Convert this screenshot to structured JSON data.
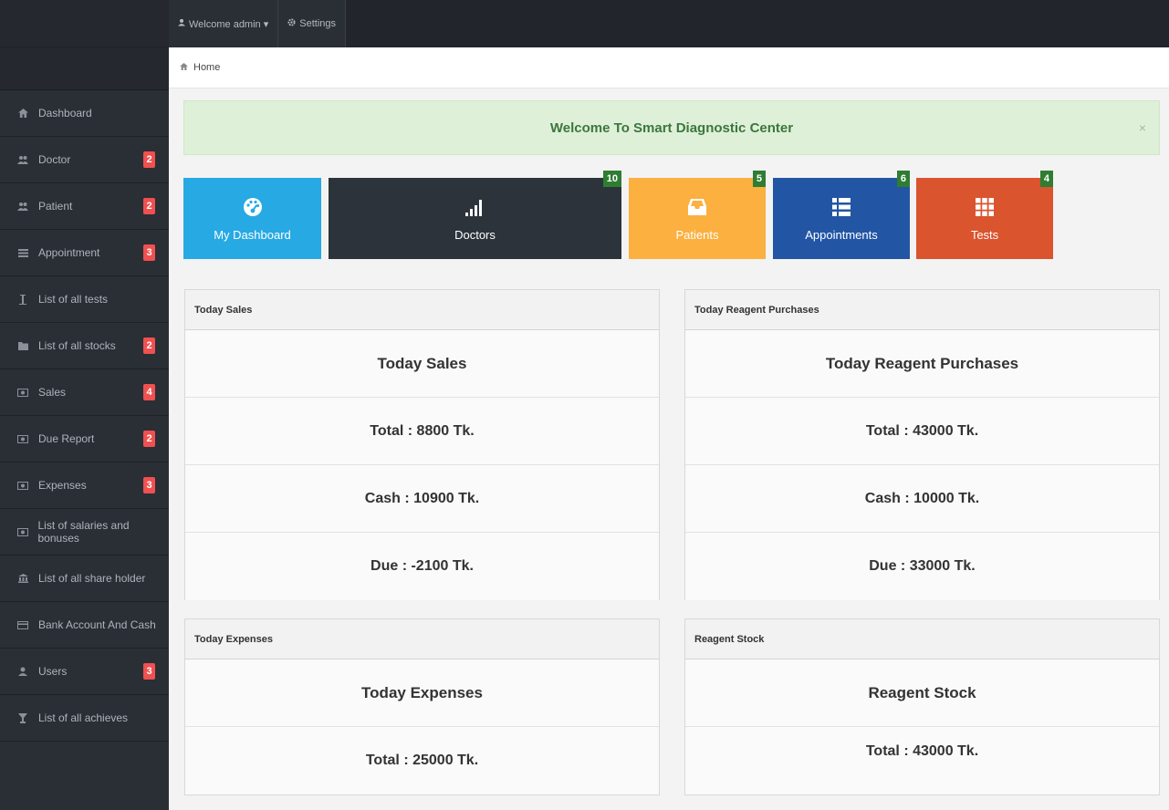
{
  "topbar": {
    "welcome": "Welcome admin ▾",
    "settings": "Settings"
  },
  "breadcrumb": {
    "home": "Home"
  },
  "sidebar": {
    "items": [
      {
        "label": "Dashboard",
        "icon": "home-icon",
        "badge": ""
      },
      {
        "label": "Doctor",
        "icon": "users-icon",
        "badge": "2"
      },
      {
        "label": "Patient",
        "icon": "users-icon",
        "badge": "2"
      },
      {
        "label": "Appointment",
        "icon": "list-icon",
        "badge": "3"
      },
      {
        "label": "List of all tests",
        "icon": "beaker-icon",
        "badge": ""
      },
      {
        "label": "List of all stocks",
        "icon": "folder-icon",
        "badge": "2"
      },
      {
        "label": "Sales",
        "icon": "money-icon",
        "badge": "4"
      },
      {
        "label": "Due Report",
        "icon": "money-icon",
        "badge": "2"
      },
      {
        "label": "Expenses",
        "icon": "money-icon",
        "badge": "3"
      },
      {
        "label": "List of salaries and bonuses",
        "icon": "money-icon",
        "badge": ""
      },
      {
        "label": "List of all share holder",
        "icon": "bank-icon",
        "badge": ""
      },
      {
        "label": "Bank Account And Cash",
        "icon": "card-icon",
        "badge": ""
      },
      {
        "label": "Users",
        "icon": "user-icon",
        "badge": "3"
      },
      {
        "label": "List of all achieves",
        "icon": "trophy-icon",
        "badge": ""
      }
    ]
  },
  "alert": {
    "text": "Welcome To Smart Diagnostic Center",
    "close": "×"
  },
  "tiles": [
    {
      "label": "My Dashboard",
      "count": "",
      "color": "#27a9e3"
    },
    {
      "label": "Doctors",
      "count": "10",
      "color": "#2c333a"
    },
    {
      "label": "Patients",
      "count": "5",
      "color": "#fbb040"
    },
    {
      "label": "Appointments",
      "count": "6",
      "color": "#2255a4"
    },
    {
      "label": "Tests",
      "count": "4",
      "color": "#da542e"
    }
  ],
  "panels": {
    "sales": {
      "header": "Today Sales",
      "rows": [
        "Today Sales",
        "Total : 8800 Tk.",
        "Cash : 10900 Tk.",
        "Due : -2100 Tk."
      ]
    },
    "reagent_purchases": {
      "header": "Today Reagent Purchases",
      "rows": [
        "Today Reagent Purchases",
        "Total : 43000 Tk.",
        "Cash : 10000 Tk.",
        "Due : 33000 Tk."
      ]
    },
    "expenses": {
      "header": "Today Expenses",
      "rows": [
        "Today Expenses",
        "Total : 25000 Tk."
      ]
    },
    "reagent_stock": {
      "header": "Reagent Stock",
      "rows": [
        "Reagent Stock",
        "Total : 43000 Tk."
      ]
    }
  }
}
